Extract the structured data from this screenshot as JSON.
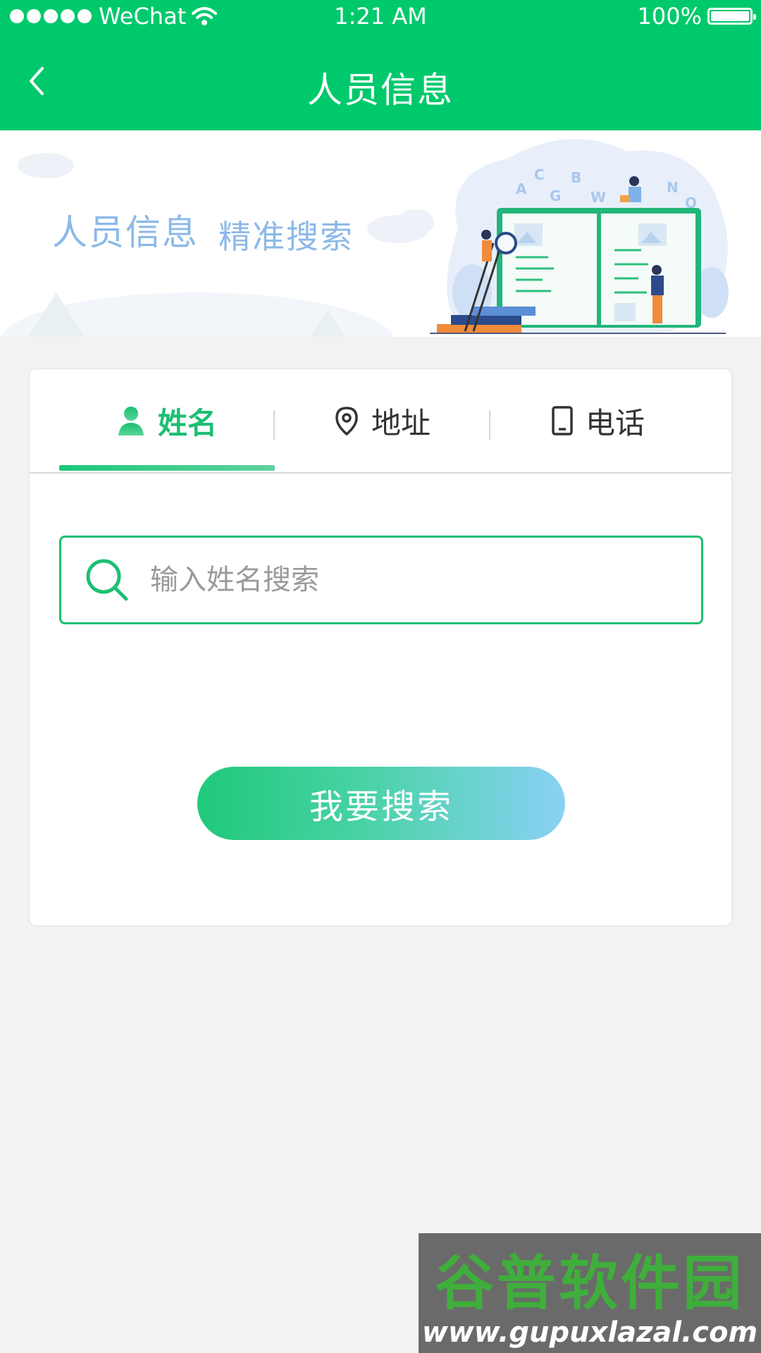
{
  "status_bar": {
    "carrier": "WeChat",
    "time": "1:21 AM",
    "battery": "100%"
  },
  "nav": {
    "title": "人员信息",
    "back_icon": "chevron-left-icon"
  },
  "banner": {
    "text_1": "人员信息",
    "text_2": "精准搜索",
    "illustration_letters": [
      "A",
      "C",
      "G",
      "B",
      "W",
      "N",
      "Q"
    ]
  },
  "tabs": [
    {
      "label": "姓名",
      "icon": "person-icon",
      "active": true
    },
    {
      "label": "地址",
      "icon": "location-pin-icon",
      "active": false
    },
    {
      "label": "电话",
      "icon": "phone-icon",
      "active": false
    }
  ],
  "search": {
    "placeholder": "输入姓名搜索",
    "value": "",
    "icon": "search-icon"
  },
  "search_button": {
    "label": "我要搜索"
  },
  "watermark": {
    "title": "谷普软件园",
    "url": "www.gupuxlazal.com"
  },
  "colors": {
    "primary": "#00c96c",
    "banner_text": "#8cb9e8",
    "background": "#f2f2f2"
  }
}
